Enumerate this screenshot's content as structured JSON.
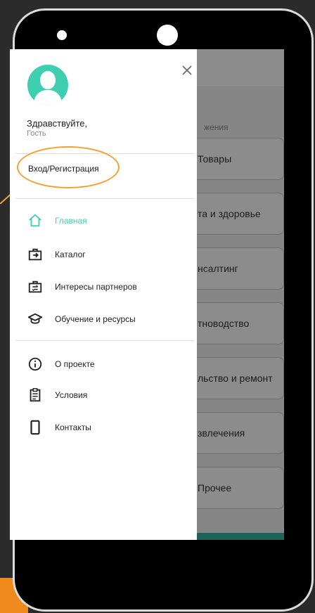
{
  "drawer": {
    "greeting": "Здравствуйте,",
    "guest": "Гость",
    "login_label": "Вход/Регистрация",
    "menu_primary": [
      {
        "label": "Главная",
        "icon": "home-icon",
        "active": true
      },
      {
        "label": "Каталог",
        "icon": "briefcase-arrow-icon"
      },
      {
        "label": "Интересы партнеров",
        "icon": "briefcase-exchange-icon"
      },
      {
        "label": "Обучение и ресурсы",
        "icon": "graduation-cap-icon"
      }
    ],
    "menu_secondary": [
      {
        "label": "О проекте",
        "icon": "info-icon"
      },
      {
        "label": "Условия",
        "icon": "clipboard-icon"
      },
      {
        "label": "Контакты",
        "icon": "phone-icon"
      }
    ]
  },
  "background": {
    "section_title": "жения",
    "cards": [
      "Товары",
      "та и здоровье",
      "нсалтинг",
      "тноводство",
      "льство и ремонт",
      "звлечения",
      "Прочее"
    ]
  },
  "colors": {
    "accent": "#3ecfb1",
    "highlight": "#f3a133",
    "button": "#3bb4a2"
  }
}
